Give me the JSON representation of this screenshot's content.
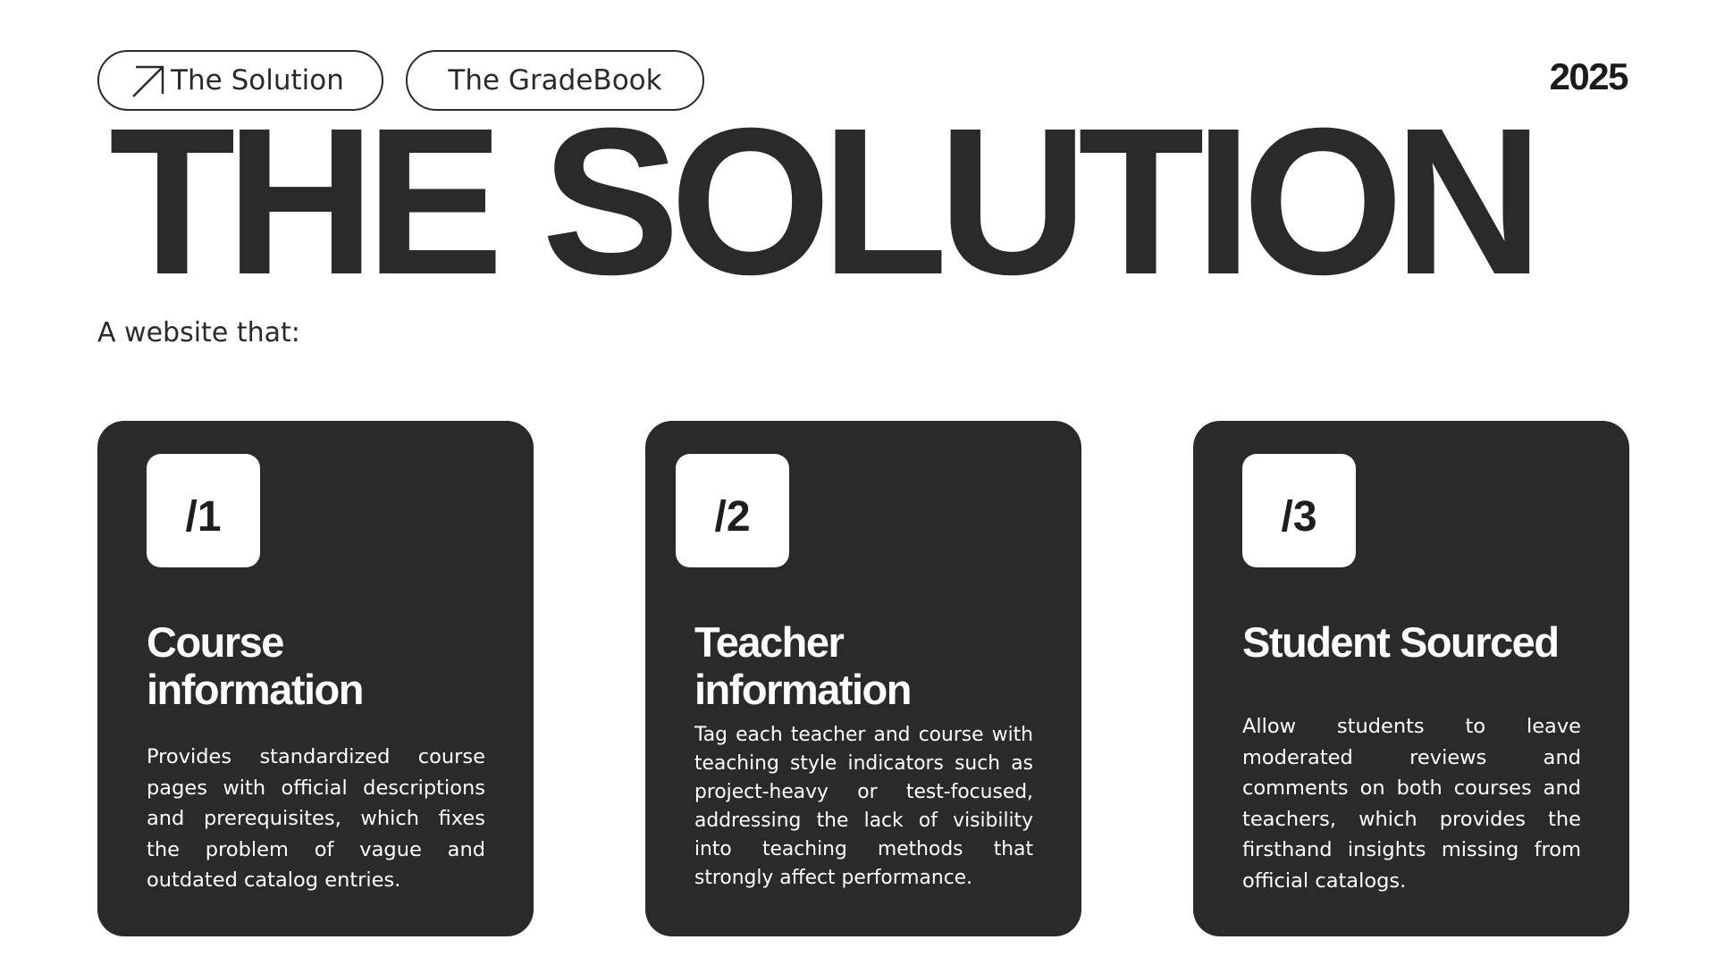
{
  "header": {
    "tag_primary": "The Solution",
    "tag_secondary": "The GradeBook",
    "year": "2025"
  },
  "hero": {
    "title": "THE SOLUTION",
    "subtitle": "A website that:"
  },
  "cards": [
    {
      "number": "/1",
      "title": "Course information",
      "description": "Provides standardized course pages with official descriptions and prerequisites, which fixes the problem of vague and outdated catalog entries."
    },
    {
      "number": "/2",
      "title": "Teacher information",
      "description": "Tag each teacher and course with teaching style indicators such as project-heavy or test-focused, addressing the lack of visibility into teaching methods that strongly affect performance."
    },
    {
      "number": "/3",
      "title": "Student Sourced",
      "description": "Allow students to leave moderated reviews and comments on both courses and teachers, which provides the firsthand insights missing from official catalogs."
    }
  ],
  "icons": {
    "tag_primary_icon": "arrow-up-right-icon"
  },
  "colors": {
    "ink": "#2a2a2a",
    "background": "#ffffff",
    "card_text": "#ffffff"
  }
}
